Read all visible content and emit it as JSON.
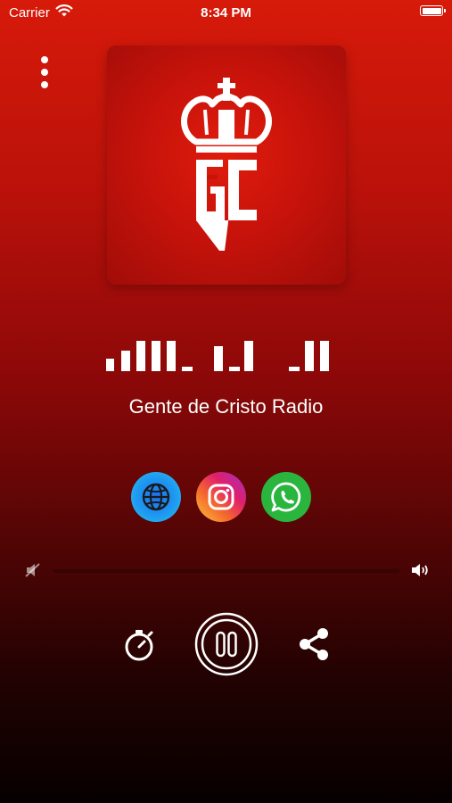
{
  "status_bar": {
    "carrier": "Carrier",
    "time": "8:34 PM"
  },
  "artwork": {
    "logo_text": "GC"
  },
  "station": {
    "name": "Gente de Cristo Radio"
  },
  "social_links": [
    {
      "name": "website",
      "icon": "globe-icon"
    },
    {
      "name": "instagram",
      "icon": "instagram-icon"
    },
    {
      "name": "whatsapp",
      "icon": "whatsapp-icon"
    }
  ],
  "player": {
    "state": "playing",
    "volume": 0
  },
  "colors": {
    "background_top": "#d71a0a",
    "background_bottom": "#060000",
    "accent_white": "#ffffff"
  }
}
